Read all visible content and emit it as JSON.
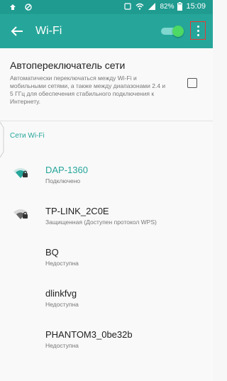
{
  "status_bar": {
    "battery": "82%",
    "time": "15:09"
  },
  "app_bar": {
    "title": "Wi-Fi",
    "wifi_enabled": true
  },
  "auto_switch": {
    "title": "Автопереключатель сети",
    "description": "Автоматически переключаться между Wi-Fi и мобильными сетями, а также между диапазонами 2.4 и 5 ГГц для обеспечения стабильного подключения к Интернету.",
    "checked": false
  },
  "section": {
    "title": "Сети Wi-Fi"
  },
  "networks": [
    {
      "ssid": "DAP-1360",
      "status": "Подключено",
      "connected": true,
      "secured": true
    },
    {
      "ssid": "TP-LINK_2C0E",
      "status": "Защищенная (Доступен протокол WPS)",
      "connected": false,
      "secured": true
    },
    {
      "ssid": "BQ",
      "status": "Недоступна",
      "connected": false,
      "secured": false
    },
    {
      "ssid": "dlinkfvg",
      "status": "Недоступна",
      "connected": false,
      "secured": false
    },
    {
      "ssid": "PHANTOM3_0be32b",
      "status": "Недоступна",
      "connected": false,
      "secured": false
    }
  ],
  "colors": {
    "accent": "#26a69a",
    "status_bar": "#1f9b90",
    "highlight_border": "#e53935"
  }
}
